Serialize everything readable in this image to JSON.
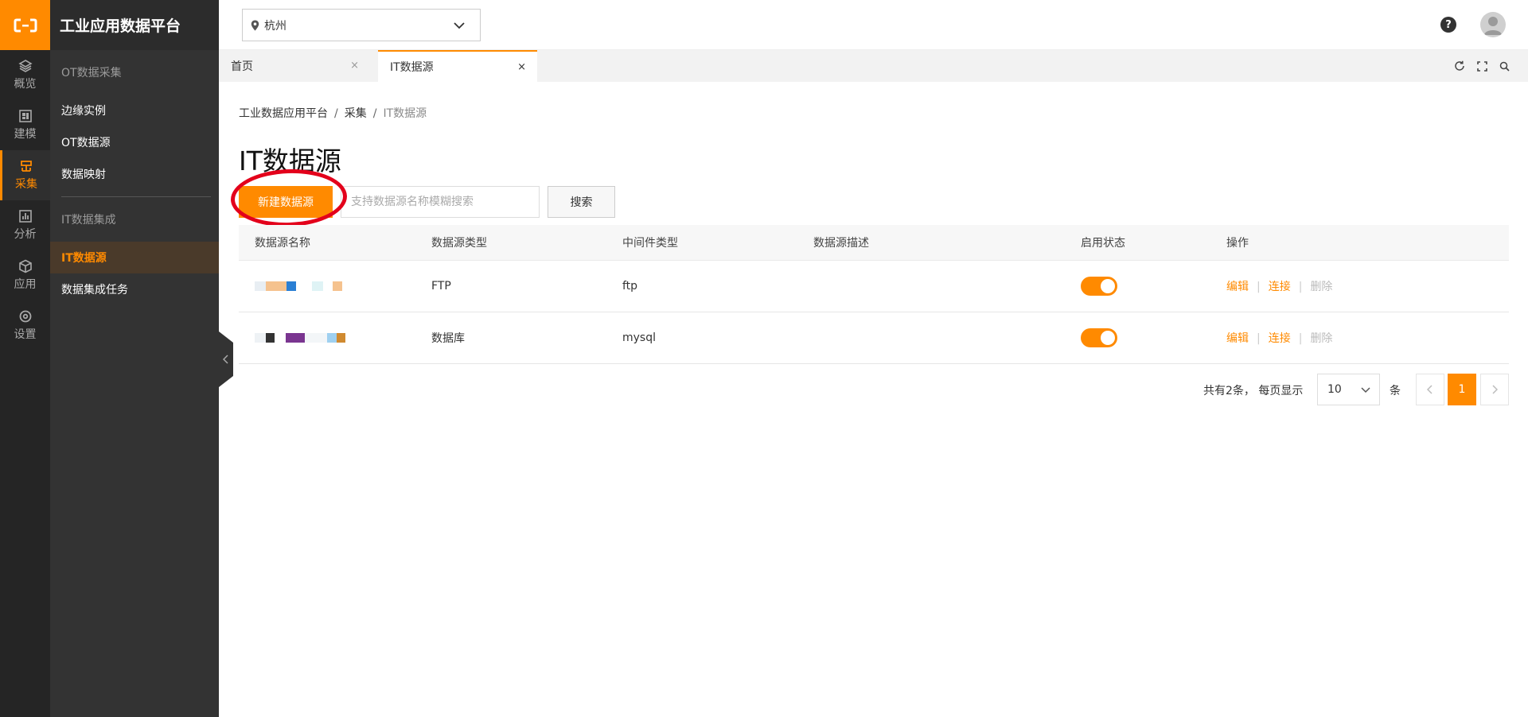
{
  "app": {
    "title": "工业应用数据平台"
  },
  "rail": {
    "items": [
      {
        "label": "概览",
        "icon": "layers-icon"
      },
      {
        "label": "建模",
        "icon": "model-icon"
      },
      {
        "label": "采集",
        "icon": "collect-icon",
        "active": true
      },
      {
        "label": "分析",
        "icon": "chart-icon"
      },
      {
        "label": "应用",
        "icon": "cube-icon"
      },
      {
        "label": "设置",
        "icon": "gear-icon"
      }
    ]
  },
  "nav": {
    "group1": "OT数据采集",
    "items1": [
      "边缘实例",
      "OT数据源",
      "数据映射"
    ],
    "group2": "IT数据集成",
    "items2": [
      "IT数据源",
      "数据集成任务"
    ]
  },
  "topbar": {
    "region": "杭州",
    "help": "?"
  },
  "tabs": [
    {
      "label": "首页",
      "close": "×"
    },
    {
      "label": "IT数据源",
      "close": "×",
      "active": true
    }
  ],
  "breadcrumb": [
    "工业数据应用平台",
    "采集",
    "IT数据源"
  ],
  "breadcrumb_sep": "/",
  "page_title": "IT数据源",
  "toolbar": {
    "new_label": "新建数据源",
    "search_placeholder": "支持数据源名称模糊搜索",
    "search_label": "搜索"
  },
  "table": {
    "columns": [
      "数据源名称",
      "数据源类型",
      "中间件类型",
      "数据源描述",
      "启用状态",
      "操作"
    ],
    "rows": [
      {
        "type": "FTP",
        "middleware": "ftp",
        "description": "",
        "enabled": true
      },
      {
        "type": "数据库",
        "middleware": "mysql",
        "description": "",
        "enabled": true
      }
    ],
    "ops": {
      "edit": "编辑",
      "connect": "连接",
      "delete": "删除",
      "sep": "|"
    }
  },
  "pagination": {
    "total_text": "共有2条，  每页显示",
    "page_size": "10",
    "unit": "条",
    "current_page": "1"
  },
  "colors": {
    "accent": "#ff8a00",
    "sidebar": "#252525",
    "annotation": "#e3001b"
  }
}
